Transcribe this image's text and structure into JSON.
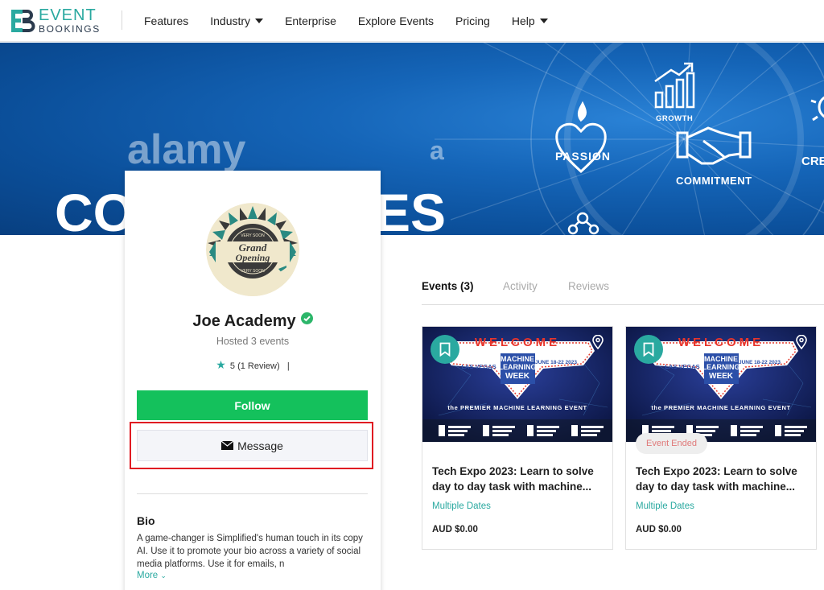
{
  "brand": {
    "line1": "EVENT",
    "line2": "BOOKINGS",
    "mark": "EB"
  },
  "nav": {
    "features": "Features",
    "industry": "Industry",
    "enterprise": "Enterprise",
    "explore": "Explore Events",
    "pricing": "Pricing",
    "help": "Help"
  },
  "banner": {
    "watermark": "alamy",
    "watermark_small": "a",
    "big_left": "CO",
    "big_right": "ES",
    "icons": {
      "passion": "PASSION",
      "growth": "GROWTH",
      "commitment": "COMMITMENT",
      "cre": "CRE"
    }
  },
  "profile": {
    "name": "Joe Academy",
    "hosted": "Hosted 3 events",
    "rating_value": "5",
    "rating_reviews": "(1 Review)",
    "rating_sep": "|",
    "follow_label": "Follow",
    "message_label": "Message",
    "avatar": {
      "line1": "Grand",
      "line2": "Opening",
      "top": "VERY SOON",
      "bottom": "VERY SOON"
    },
    "bio_title": "Bio",
    "bio_text": "A game-changer is Simplified's human touch in its copy AI. Use it to promote your bio across a variety of social media platforms. Use it for emails, n",
    "more_label": "More"
  },
  "tabs": {
    "events": "Events (3)",
    "activity": "Activity",
    "reviews": "Reviews"
  },
  "events": [
    {
      "title_line1": "Tech Expo 2023: Learn to solve",
      "title_line2": "day to day task with machine...",
      "dates": "Multiple Dates",
      "price": "AUD $0.00",
      "badge": "",
      "poster": {
        "welcome": "WELCOME",
        "ml1": "MACHINE",
        "ml2": "LEARNING",
        "ml3": "WEEK",
        "place": "LAS VEGAS",
        "date": "JUNE 18-22 2023",
        "tagline": "the PREMIER MACHINE LEARNING EVENT"
      }
    },
    {
      "title_line1": "Tech Expo 2023: Learn to solve",
      "title_line2": "day to day task with machine...",
      "dates": "Multiple Dates",
      "price": "AUD $0.00",
      "badge": "Event Ended",
      "poster": {
        "welcome": "WELCOME",
        "ml1": "MACHINE",
        "ml2": "LEARNING",
        "ml3": "WEEK",
        "place": "LAS VEGAS",
        "date": "JUNE 18-22 2023",
        "tagline": "the PREMIER MACHINE LEARNING EVENT"
      }
    }
  ],
  "colors": {
    "accent": "#2aa9a0",
    "follow": "#14c15c",
    "highlight": "#e01b22",
    "banner": "#1565b8"
  }
}
